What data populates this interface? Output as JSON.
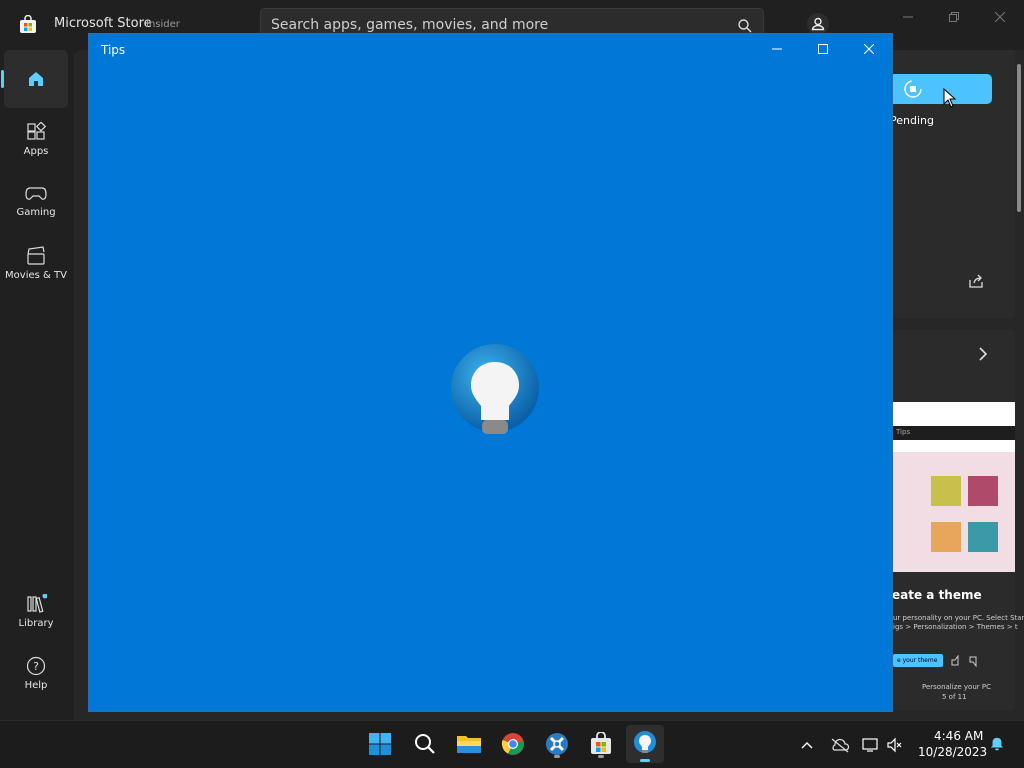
{
  "store": {
    "title": "Microsoft Store",
    "channel": "Insider",
    "search_placeholder": "Search apps, games, movies, and more",
    "nav": [
      {
        "label": "Apps"
      },
      {
        "label": "Gaming"
      },
      {
        "label": "Movies & TV"
      },
      {
        "label": "Library"
      },
      {
        "label": "Help"
      }
    ],
    "install_status": "Pending",
    "tips_card": {
      "search_hint": "Tips",
      "title": "eate a theme",
      "line1": "ur personality on your PC. Select Start",
      "line2": "igs > Personalization > Themes > t",
      "button": "e your theme",
      "footer_title": "Personalize your PC",
      "footer_count": "5 of 11"
    },
    "accent_color": "#4cc2ff"
  },
  "tips_window": {
    "title": "Tips",
    "background": "#0078d7"
  },
  "taskbar": {
    "apps": [
      "start-icon",
      "search-icon",
      "file-explorer-icon",
      "chrome-icon",
      "cross-app-icon",
      "store-icon",
      "tips-icon"
    ],
    "time": "4:46 AM",
    "date": "10/28/2023"
  }
}
